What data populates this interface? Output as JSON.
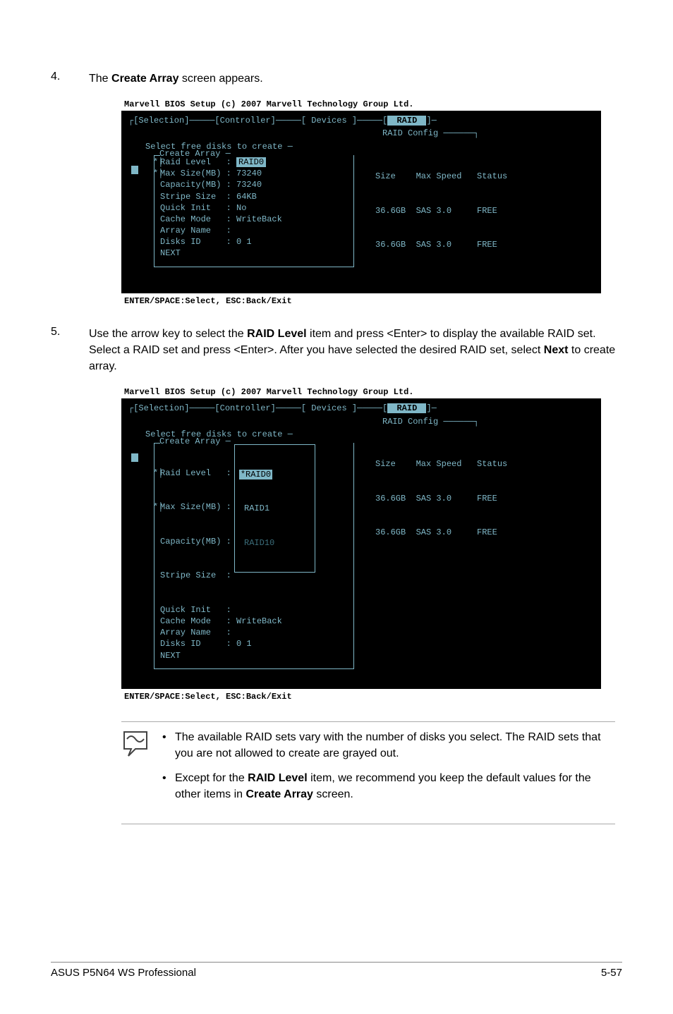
{
  "step4": {
    "num": "4.",
    "text_pre": "The ",
    "bold": "Create Array",
    "text_post": " screen appears."
  },
  "bios1": {
    "title": "Marvell BIOS Setup (c) 2007 Marvell Technology Group Ltd.",
    "tabs": "┌[Selection]─────[Controller]─────[ Devices ]─────[",
    "tab_active": " RAID ",
    "tabs_end": "]─",
    "raid_config": "RAID Config ──────┐",
    "sel_free": "Select free disks to create ─",
    "create_hdr": "Create Array ─",
    "fields": {
      "raid_level_lbl": "Raid Level   : ",
      "raid_level_val": "RAID0",
      "max_size": "Max Size(MB) : 73240",
      "capacity": "Capacity(MB) : 73240",
      "stripe": "Stripe Size  : 64KB",
      "quick": "Quick Init   : No",
      "cache": "Cache Mode   : WriteBack",
      "array_name": "Array Name   :",
      "disks_id": "Disks ID     : 0 1",
      "next": "NEXT"
    },
    "disk_hdr": "Size    Max Speed   Status",
    "disk1": "36.6GB  SAS 3.0     FREE",
    "disk2": "36.6GB  SAS 3.0     FREE",
    "footer": "ENTER/SPACE:Select, ESC:Back/Exit"
  },
  "step5": {
    "num": "5.",
    "line1_pre": "Use the arrow key to select the ",
    "line1_bold": "RAID Level",
    "line1_post": " item and press <Enter> to display the available RAID set. Select a RAID set and press <Enter>. After you have selected the desired RAID set, select ",
    "line1_bold2": "Next",
    "line1_end": " to create array."
  },
  "bios2": {
    "title": "Marvell BIOS Setup (c) 2007 Marvell Technology Group Ltd.",
    "fields": {
      "raid_level_lbl": "Raid Level   :",
      "max_size": "Max Size(MB) :",
      "capacity": "Capacity(MB) :",
      "stripe": "Stripe Size  :",
      "quick": "Quick Init   :",
      "cache": "Cache Mode   : WriteBack",
      "array_name": "Array Name   :",
      "disks_id": "Disks ID     : 0 1",
      "next": "NEXT"
    },
    "dropdown": {
      "opt0": "*RAID0",
      "opt1": " RAID1",
      "opt2": " RAID10"
    },
    "footer": "ENTER/SPACE:Select, ESC:Back/Exit"
  },
  "notes": {
    "n1_pre": "The available RAID sets vary with the number of disks you select. The RAID sets that you are not allowed to create are grayed out.",
    "n2_pre": "Except for the ",
    "n2_bold": "RAID Level",
    "n2_mid": " item, we recommend you keep the default values for the other items in ",
    "n2_bold2": "Create Array",
    "n2_end": " screen."
  },
  "footer": {
    "left": "ASUS P5N64 WS Professional",
    "right": "5-57"
  },
  "chart_data": {
    "type": "table",
    "title": "Select free disks to create",
    "columns": [
      "Size",
      "Max Speed",
      "Status"
    ],
    "rows": [
      [
        "36.6GB",
        "SAS 3.0",
        "FREE"
      ],
      [
        "36.6GB",
        "SAS 3.0",
        "FREE"
      ]
    ]
  }
}
